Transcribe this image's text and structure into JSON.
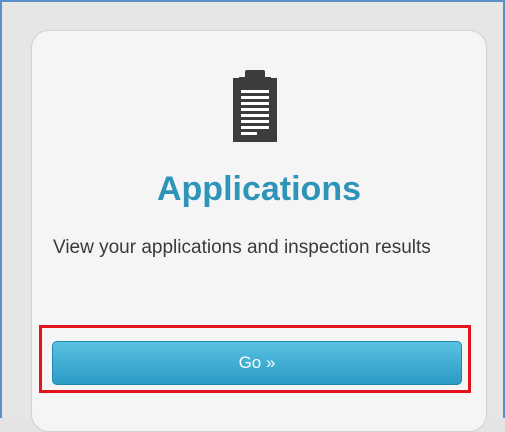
{
  "card": {
    "icon": "clipboard-icon",
    "title": "Applications",
    "description": "View your applications and inspection results",
    "button_label": "Go »"
  },
  "colors": {
    "title": "#2e94b9",
    "button_top": "#5ac1e2",
    "button_bottom": "#2b9bc6",
    "highlight": "#e3141c"
  }
}
